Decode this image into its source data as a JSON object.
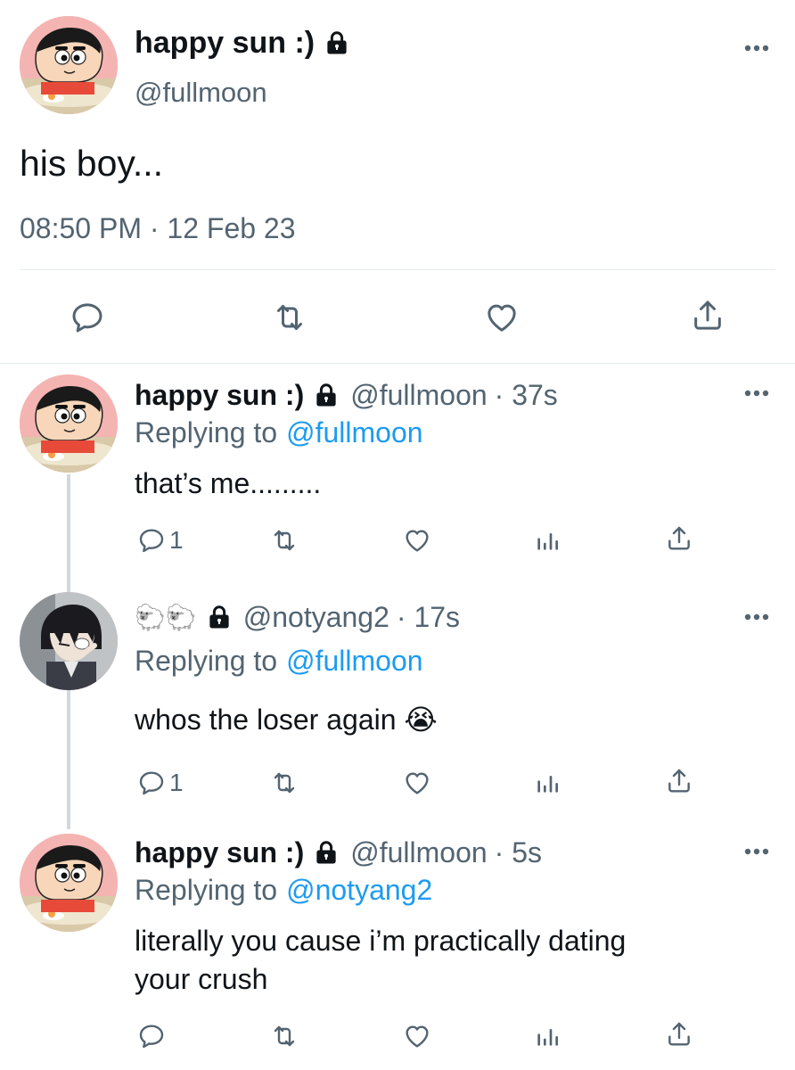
{
  "main_tweet": {
    "display_name": "happy sun :)",
    "handle": "@fullmoon",
    "text": "his boy...",
    "timestamp": "08:50 PM · 12 Feb 23",
    "avatar_icon": "shinchan-avatar",
    "actions": [
      "reply-icon",
      "retweet-icon",
      "like-icon",
      "share-icon"
    ]
  },
  "replies": [
    {
      "display_name": "happy sun :)",
      "handle": "@fullmoon",
      "time": "· 37s",
      "replying_prefix": "Replying to",
      "replying_to": "@fullmoon",
      "text": "that’s me.........",
      "reply_count": "1",
      "avatar_icon": "shinchan-avatar"
    },
    {
      "display_name": "🐑🐑",
      "handle": "@notyang2",
      "time": "· 17s",
      "replying_prefix": "Replying to",
      "replying_to": "@fullmoon",
      "text": "whos the loser again 😭",
      "reply_count": "1",
      "avatar_icon": "anime-boy-avatar"
    },
    {
      "display_name": "happy sun :)",
      "handle": "@fullmoon",
      "time": "· 5s",
      "replying_prefix": "Replying to",
      "replying_to": "@notyang2",
      "text_line1": "literally you cause i’m practically dating",
      "text_line2": "your crush",
      "reply_count": "",
      "avatar_icon": "shinchan-avatar"
    }
  ],
  "colors": {
    "text": "#0f1419",
    "secondary": "#536471",
    "link": "#1d9bf0",
    "divider": "#e6ecf0",
    "thread_line": "#cfd9de"
  }
}
